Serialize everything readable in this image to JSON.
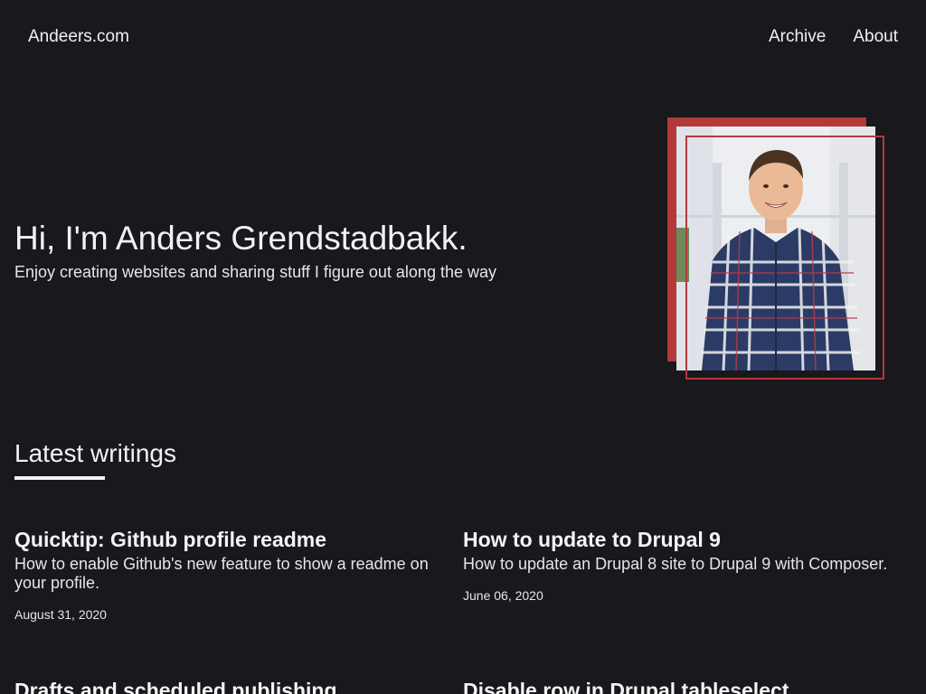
{
  "header": {
    "brand": "Andeers.com",
    "nav": [
      {
        "label": "Archive"
      },
      {
        "label": "About"
      }
    ]
  },
  "hero": {
    "title": "Hi, I'm Anders Grendstadbakk.",
    "subtitle": "Enjoy creating websites and sharing stuff I figure out along the way"
  },
  "colors": {
    "background": "#19181d",
    "accent": "#b23a3a",
    "text": "#ececec"
  },
  "latest": {
    "heading": "Latest writings",
    "posts": [
      {
        "title": "Quicktip: Github profile readme",
        "description": "How to enable Github's new feature to show a readme on your profile.",
        "date": "August 31, 2020"
      },
      {
        "title": "How to update to Drupal 9",
        "description": "How to update an Drupal 8 site to Drupal 9 with Composer.",
        "date": "June 06, 2020"
      },
      {
        "title": "Drafts and scheduled publishing",
        "description": "",
        "date": ""
      },
      {
        "title": "Disable row in Drupal tableselect",
        "description": "",
        "date": ""
      }
    ]
  }
}
